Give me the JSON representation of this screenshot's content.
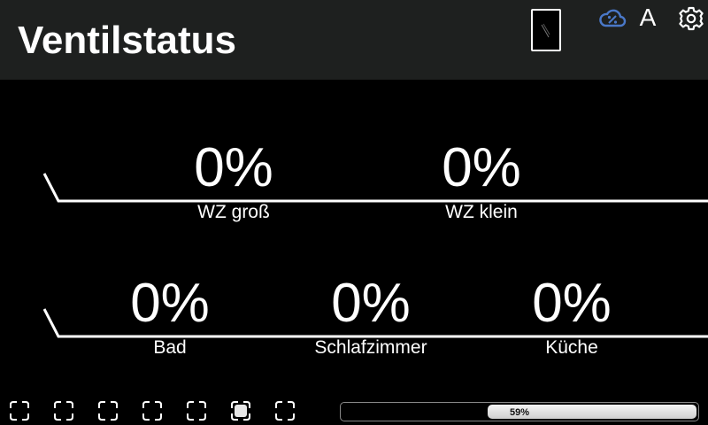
{
  "header": {
    "title": "Ventilstatus",
    "mode_letter": "A",
    "icons": [
      "window-icon",
      "cloud-percent-icon",
      "gear-icon"
    ],
    "accent_color": "#4a78c8"
  },
  "valves": {
    "row1": [
      {
        "label": "WZ groß",
        "value": "0%"
      },
      {
        "label": "WZ klein",
        "value": "0%"
      }
    ],
    "row2": [
      {
        "label": "Bad",
        "value": "0%"
      },
      {
        "label": "Schlafzimmer",
        "value": "0%"
      },
      {
        "label": "Küche",
        "value": "0%"
      }
    ]
  },
  "pagination": {
    "page_count": 7,
    "active_page": 6
  },
  "progress": {
    "text": "59%",
    "value": 0.59
  }
}
